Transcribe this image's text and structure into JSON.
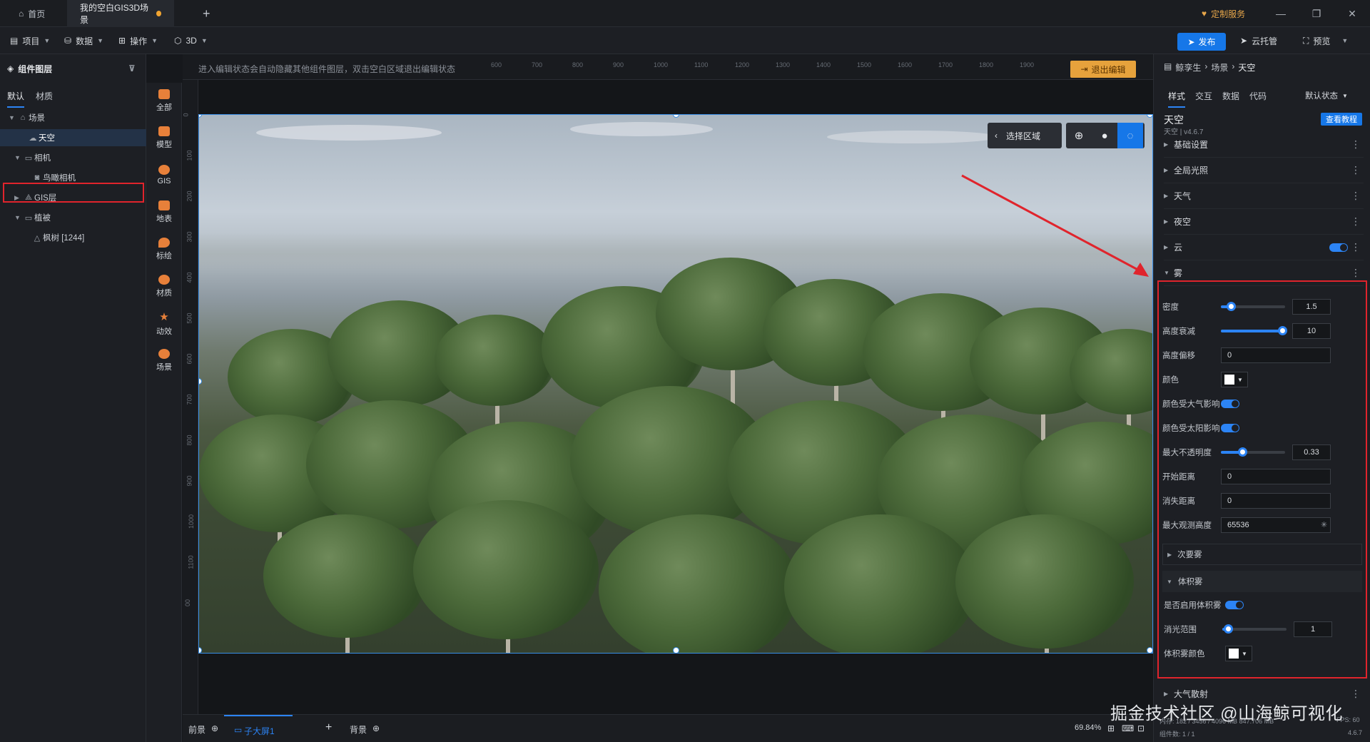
{
  "titlebar": {
    "home_tab": "首页",
    "scene_tab": "我的空白GIS3D场景",
    "custom_service": "定制服务"
  },
  "menubar": {
    "project": "项目",
    "data": "数据",
    "operate": "操作",
    "mode_3d": "3D",
    "publish": "发布",
    "cloud_host": "云托管",
    "preview": "预览"
  },
  "left_panel": {
    "title": "组件图层",
    "tabs": [
      "默认",
      "材质"
    ],
    "tree": [
      {
        "label": "场景",
        "level": 0
      },
      {
        "label": "天空",
        "level": 1,
        "selected": true
      },
      {
        "label": "相机",
        "level": 1
      },
      {
        "label": "鸟瞰相机",
        "level": 2
      },
      {
        "label": "GIS层",
        "level": 1
      },
      {
        "label": "植被",
        "level": 1
      },
      {
        "label": "枫树 [1244]",
        "level": 2
      }
    ]
  },
  "rail": [
    "全部",
    "模型",
    "GIS",
    "地表",
    "标绘",
    "材质",
    "动效",
    "场景"
  ],
  "canvas": {
    "hint": "进入编辑状态会自动隐藏其他组件图层，双击空白区域退出编辑状态",
    "exit_edit": "退出编辑",
    "ruler_top": [
      "600",
      "700",
      "800",
      "900",
      "1000",
      "1100",
      "1200",
      "1300",
      "1400",
      "1500",
      "1600",
      "1700",
      "1800",
      "1900"
    ],
    "ruler_left": [
      "0",
      "100",
      "200",
      "300",
      "400",
      "500",
      "600",
      "700",
      "800",
      "900",
      "1000",
      "1100",
      "00"
    ],
    "select_region": "选择区域"
  },
  "bottom": {
    "foreground": "前景",
    "sub_screen": "子大屏1",
    "background": "背景",
    "zoom": "69.84%",
    "stats": "内存: 182 / 3456 / 4096 MB  847.706 MB",
    "fps": "FPS: 60",
    "component_count": "组件数: 1 / 1",
    "version": "4.6.7"
  },
  "right_panel": {
    "breadcrumb": [
      "鲸孪生",
      "场景",
      "天空"
    ],
    "tabs": [
      "样式",
      "交互",
      "数据",
      "代码"
    ],
    "state_select": "默认状态",
    "component_name": "天空",
    "component_sub": "天空 | v4.6.7",
    "tutorial": "查看教程",
    "sections": [
      "基础设置",
      "全局光照",
      "天气",
      "夜空",
      "云",
      "雾"
    ],
    "fog": {
      "density_label": "密度",
      "density": "1.5",
      "height_falloff_label": "高度衰减",
      "height_falloff": "10",
      "height_offset_label": "高度偏移",
      "height_offset": "0",
      "color_label": "颜色",
      "atmo_label": "颜色受大气影响",
      "sun_label": "颜色受太阳影响",
      "max_opacity_label": "最大不透明度",
      "max_opacity": "0.33",
      "start_dist_label": "开始距离",
      "start_dist": "0",
      "vanish_dist_label": "消失距离",
      "vanish_dist": "0",
      "max_height_label": "最大观测高度",
      "max_height": "65536",
      "secondary": "次要雾",
      "volumetric": "体积雾",
      "vol_enable_label": "是否启用体积雾",
      "vol_range_label": "消光范围",
      "vol_range": "1",
      "vol_color_label": "体积雾颜色"
    },
    "last_section": "大气散射"
  },
  "watermark": "掘金技术社区 @山海鲸可视化",
  "colors": {
    "accent": "#2c84f5",
    "highlight": "#e0242c",
    "exit_button": "#e6a23c"
  }
}
